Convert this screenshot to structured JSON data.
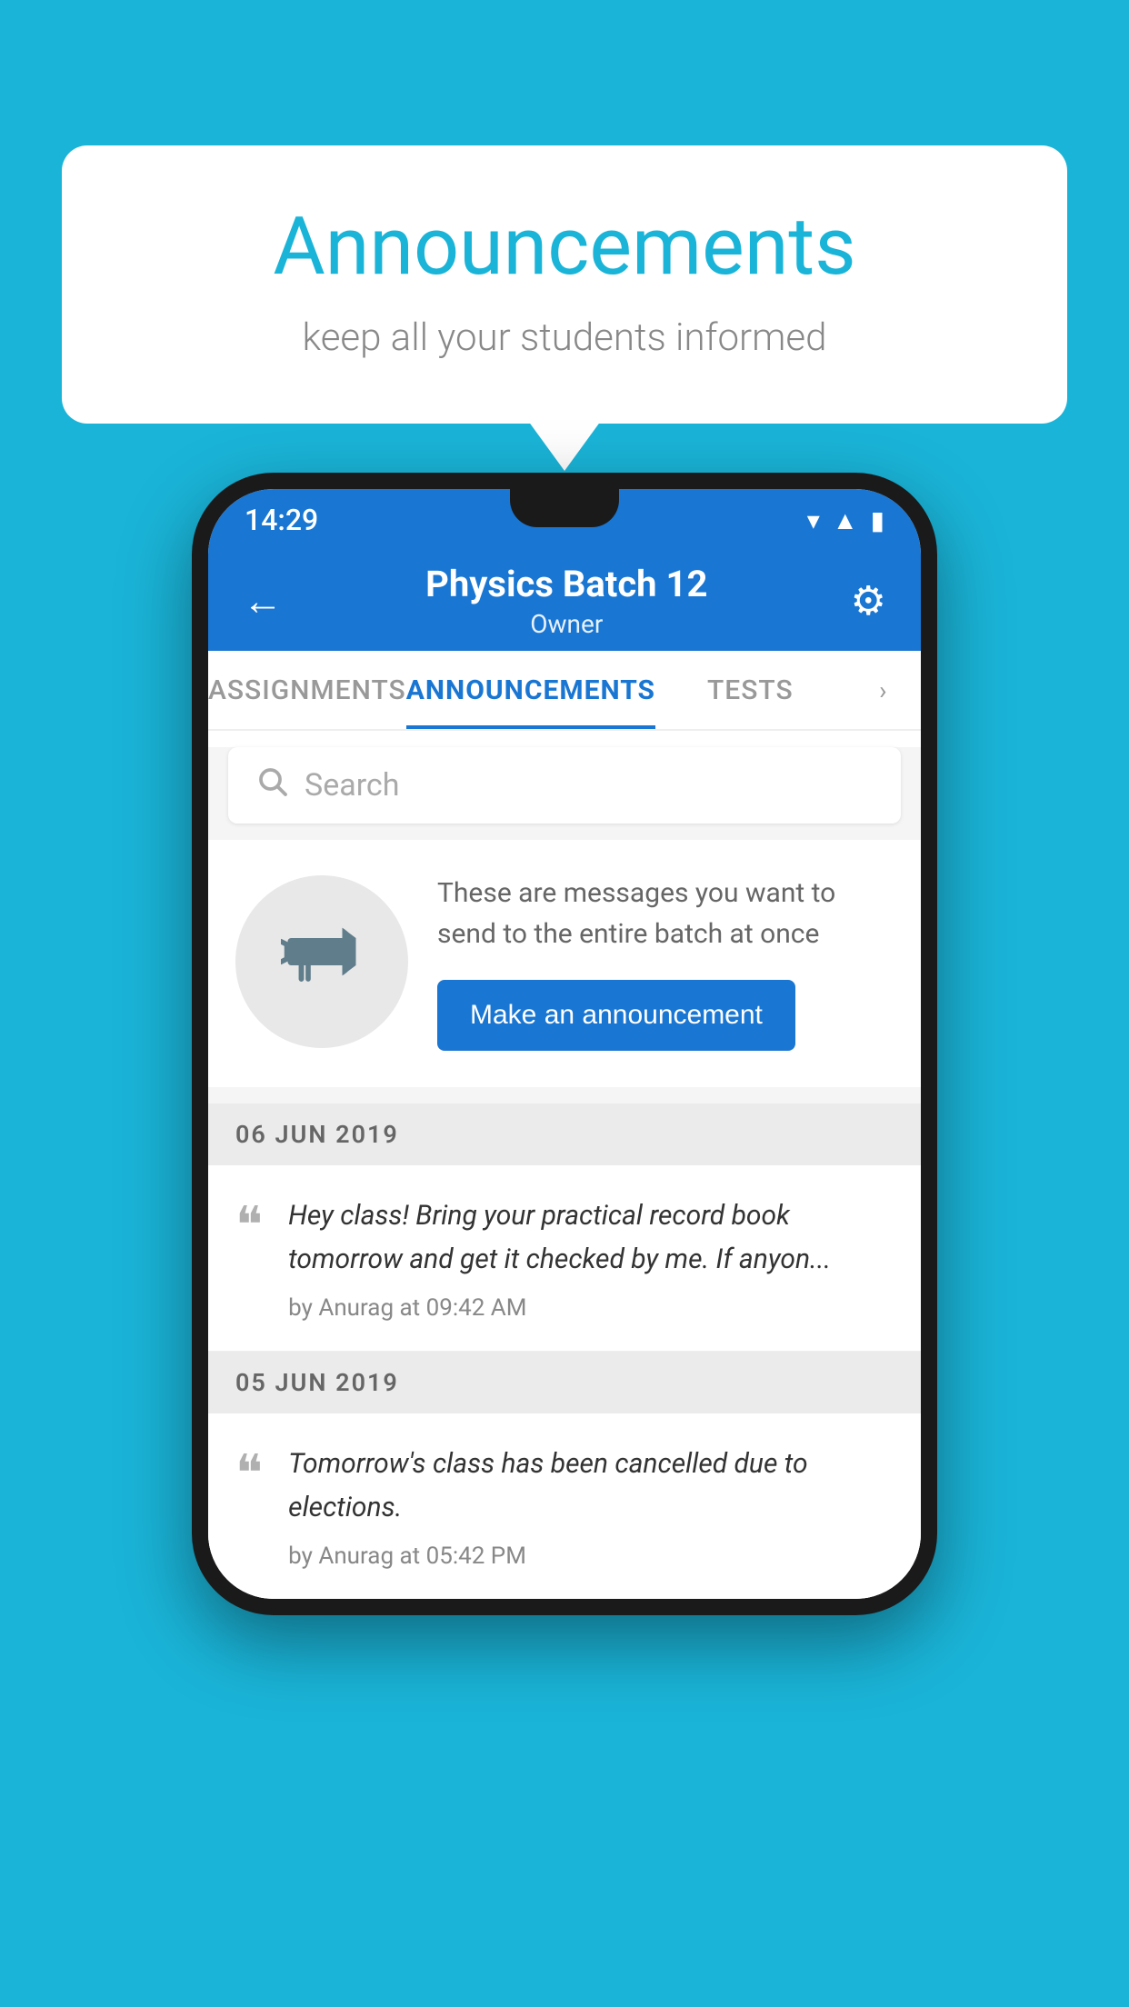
{
  "background": {
    "color": "#1ab4d8"
  },
  "speech_bubble": {
    "title": "Announcements",
    "subtitle": "keep all your students informed"
  },
  "status_bar": {
    "time": "14:29",
    "wifi_icon": "▲",
    "signal_icon": "▲",
    "battery_icon": "▮"
  },
  "app_bar": {
    "back_icon": "←",
    "title": "Physics Batch 12",
    "subtitle": "Owner",
    "settings_icon": "⚙"
  },
  "tabs": [
    {
      "label": "ASSIGNMENTS",
      "active": false
    },
    {
      "label": "ANNOUNCEMENTS",
      "active": true
    },
    {
      "label": "TESTS",
      "active": false
    }
  ],
  "search": {
    "placeholder": "Search"
  },
  "announcement_prompt": {
    "description": "These are messages you want to send to the entire batch at once",
    "button_label": "Make an announcement"
  },
  "announcements": [
    {
      "date": "06  JUN  2019",
      "message": "Hey class! Bring your practical record book tomorrow and get it checked by me. If anyon...",
      "meta": "by Anurag at 09:42 AM"
    },
    {
      "date": "05  JUN  2019",
      "message": "Tomorrow's class has been cancelled due to elections.",
      "meta": "by Anurag at 05:42 PM"
    }
  ]
}
